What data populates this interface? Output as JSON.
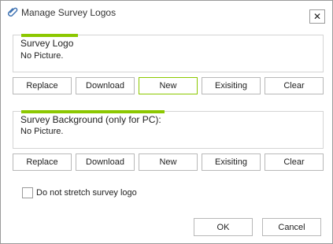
{
  "window": {
    "title": "Manage Survey Logos",
    "title_icon": "paperclip-icon",
    "close_label": "✕"
  },
  "logo_section": {
    "title": "Survey Logo",
    "value": "No Picture.",
    "buttons": {
      "replace": "Replace",
      "download": "Download",
      "new": "New",
      "existing": "Exisiting",
      "clear": "Clear"
    }
  },
  "background_section": {
    "title": "Survey Background (only for PC):",
    "value": "No Picture.",
    "buttons": {
      "replace": "Replace",
      "download": "Download",
      "new": "New",
      "existing": "Exisiting",
      "clear": "Clear"
    }
  },
  "options": {
    "stretch_label": "Do not stretch survey logo",
    "stretch_checked": false
  },
  "footer": {
    "ok": "OK",
    "cancel": "Cancel"
  },
  "colors": {
    "accent": "#8cc800",
    "border": "#b8b8b8"
  }
}
